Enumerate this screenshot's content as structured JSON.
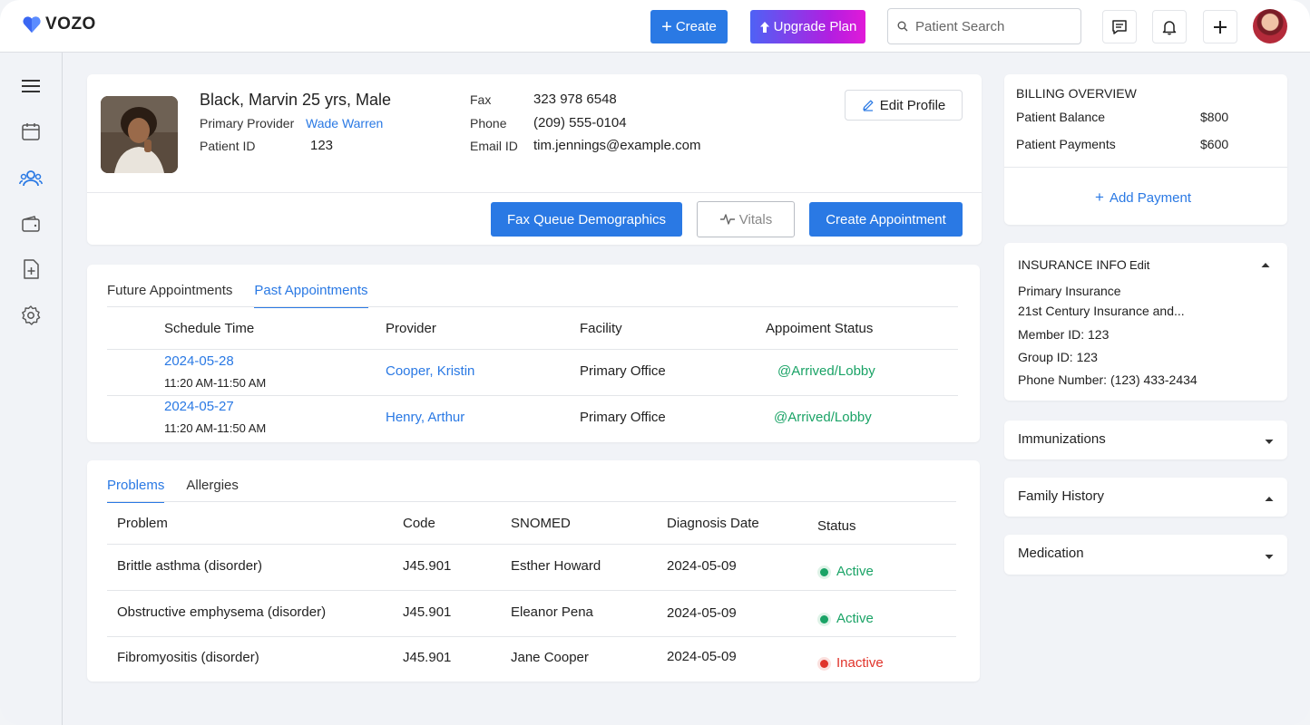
{
  "app": {
    "brand": "VOZO"
  },
  "topbar": {
    "create_label": "Create",
    "upgrade_label": "Upgrade Plan",
    "search_placeholder": "Patient Search"
  },
  "patient": {
    "name_line": "Black, Marvin 25 yrs, Male",
    "primary_provider_label": "Primary Provider",
    "primary_provider": "Wade Warren",
    "patient_id_label": "Patient ID",
    "patient_id": "123",
    "fax_label": "Fax",
    "fax": "323 978 6548",
    "phone_label": "Phone",
    "phone": "(209) 555-0104",
    "email_label": "Email ID",
    "email": "tim.jennings@example.com",
    "edit_profile_label": "Edit Profile",
    "fax_queue_label": "Fax Queue Demographics",
    "vitals_label": "Vitals",
    "create_appointment_label": "Create Appointment"
  },
  "appointments": {
    "tabs": [
      "Future Appointments",
      "Past Appointments"
    ],
    "active_tab": "Past Appointments",
    "columns": [
      "Schedule Time",
      "Provider",
      "Facility",
      "Appoiment Status"
    ],
    "rows": [
      {
        "date": "2024-05-28",
        "time": "11:20 AM-11:50 AM",
        "provider": "Cooper, Kristin",
        "facility": "Primary Office",
        "status": "@Arrived/Lobby"
      },
      {
        "date": "2024-05-27",
        "time": "11:20 AM-11:50 AM",
        "provider": "Henry, Arthur",
        "facility": "Primary Office",
        "status": "@Arrived/Lobby"
      }
    ]
  },
  "problems": {
    "tabs": [
      "Problems",
      "Allergies"
    ],
    "active_tab": "Problems",
    "columns": [
      "Problem",
      "Code",
      "SNOMED",
      "Diagnosis Date",
      "Status"
    ],
    "rows": [
      {
        "problem": "Brittle asthma (disorder)",
        "code": "J45.901",
        "snomed": "Esther Howard",
        "date": "2024-05-09",
        "status": "Active"
      },
      {
        "problem": "Obstructive emphysema (disorder)",
        "code": "J45.901",
        "snomed": "Eleanor Pena",
        "date": "2024-05-09",
        "status": "Active"
      },
      {
        "problem": "Fibromyositis (disorder)",
        "code": "J45.901",
        "snomed": "Jane Cooper",
        "date": "2024-05-09",
        "status": "Inactive"
      }
    ]
  },
  "billing": {
    "title": "BILLING OVERVIEW",
    "balance_label": "Patient Balance",
    "balance": "$800",
    "payments_label": "Patient Payments",
    "payments": "$600",
    "add_payment_label": "Add Payment"
  },
  "insurance": {
    "title": "INSURANCE INFO",
    "edit_label": "Edit",
    "primary_label": "Primary Insurance",
    "primary_name": "21st Century Insurance and...",
    "member_id": "Member ID: 123",
    "group_id": "Group ID: 123",
    "phone": "Phone Number: (123) 433-2434"
  },
  "sections": {
    "immunizations": "Immunizations",
    "family_history": "Family History",
    "medication": "Medication"
  },
  "colors": {
    "accent": "#2a79e4",
    "active": "#1aa366",
    "inactive": "#e0332a"
  }
}
